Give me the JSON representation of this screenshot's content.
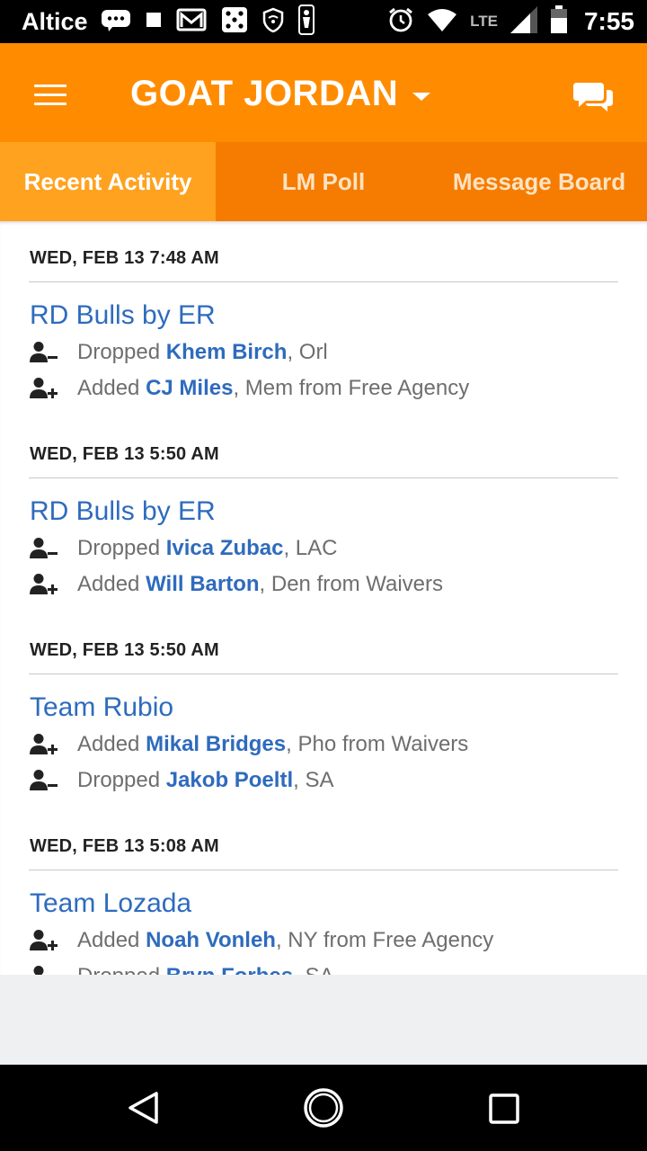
{
  "status_bar": {
    "carrier": "Altice",
    "network": "LTE",
    "time": "7:55",
    "icons": [
      "message-icon",
      "stop-icon",
      "gmail-icon",
      "dice-icon",
      "shield-wifi-icon",
      "nba-icon",
      "alarm-icon",
      "wifi-icon",
      "signal-icon",
      "battery-icon"
    ]
  },
  "app_bar": {
    "title": "GOAT JORDAN",
    "menu_icon": "hamburger-icon",
    "dropdown_icon": "caret-down-icon",
    "chat_icon": "chat-bubbles-icon"
  },
  "tabs": [
    {
      "label": "Recent Activity",
      "active": true
    },
    {
      "label": "LM Poll",
      "active": false
    },
    {
      "label": "Message Board",
      "active": false
    }
  ],
  "activity": [
    {
      "date": "WED, FEB 13  7:48 AM",
      "team": "RD Bulls by ER",
      "moves": [
        {
          "type": "drop",
          "action": "Dropped",
          "player": "Khem Birch",
          "detail": ", Orl"
        },
        {
          "type": "add",
          "action": "Added",
          "player": "CJ Miles",
          "detail": ", Mem from Free Agency"
        }
      ]
    },
    {
      "date": "WED, FEB 13  5:50 AM",
      "team": "RD Bulls by ER",
      "moves": [
        {
          "type": "drop",
          "action": "Dropped",
          "player": "Ivica Zubac",
          "detail": ", LAC"
        },
        {
          "type": "add",
          "action": "Added",
          "player": "Will Barton",
          "detail": ", Den from Waivers"
        }
      ]
    },
    {
      "date": "WED, FEB 13  5:50 AM",
      "team": "Team Rubio",
      "moves": [
        {
          "type": "add",
          "action": "Added",
          "player": "Mikal Bridges",
          "detail": ", Pho from Waivers"
        },
        {
          "type": "drop",
          "action": "Dropped",
          "player": "Jakob Poeltl",
          "detail": ", SA"
        }
      ]
    },
    {
      "date": "WED, FEB 13  5:08 AM",
      "team": "Team Lozada",
      "moves": [
        {
          "type": "add",
          "action": "Added",
          "player": "Noah Vonleh",
          "detail": ", NY from Free Agency"
        },
        {
          "type": "drop",
          "action": "Dropped",
          "player": "Bryn Forbes",
          "detail": ", SA"
        }
      ]
    }
  ],
  "nav_bar": {
    "back": "back-triangle-icon",
    "home": "home-circle-icon",
    "recents": "recents-square-icon"
  },
  "colors": {
    "app_bar": "#ff8c00",
    "tab_bg": "#f57c00",
    "tab_active": "#ffa21f",
    "link": "#2e6bbd",
    "text_muted": "#6e6e6e"
  }
}
